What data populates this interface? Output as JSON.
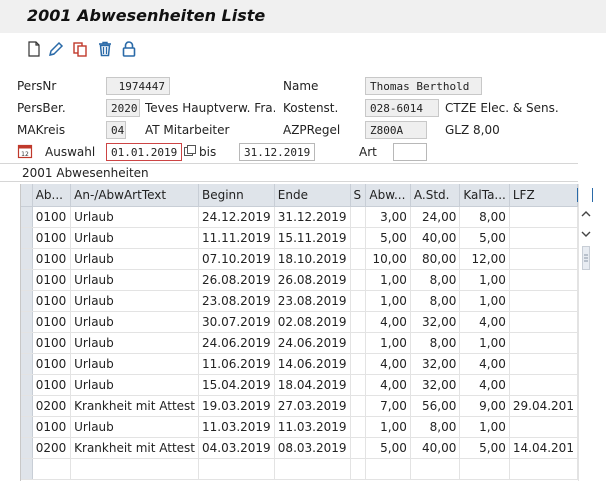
{
  "window": {
    "title": "2001 Abwesenheiten Liste"
  },
  "toolbar": {
    "icons": [
      "new-document-icon",
      "edit-pencil-icon",
      "copy-icon",
      "delete-trash-icon",
      "lock-icon"
    ]
  },
  "header": {
    "persnr_label": "PersNr",
    "persnr_value": "1974447",
    "name_label": "Name",
    "name_value": "Thomas Berthold",
    "persber_label": "PersBer.",
    "persber_value": "2020",
    "persber_text": "Teves Hauptverw. Fra...",
    "kostenst_label": "Kostenst.",
    "kostenst_value": "028-6014",
    "kostenst_text": "CTZE Elec. & Sens.",
    "makreis_label": "MAKreis",
    "makreis_value": "04",
    "makreis_text": "AT Mitarbeiter",
    "azpregel_label": "AZPRegel",
    "azpregel_value": "Z800A",
    "azpregel_text": "GLZ 8,00",
    "auswahl_label": "Auswahl",
    "auswahl_from": "01.01.2019",
    "bis_label": "bis",
    "auswahl_to": "31.12.2019",
    "art_label": "Art",
    "art_value": ""
  },
  "section": {
    "title": "2001 Abwesenheiten"
  },
  "table": {
    "columns": [
      "Ab...",
      "An-/AbwArtText",
      "Beginn",
      "Ende",
      "S",
      "Abw...",
      "A.Std.",
      "KalTa...",
      "LFZ"
    ],
    "rows": [
      [
        "0100",
        "Urlaub",
        "24.12.2019",
        "31.12.2019",
        "",
        "3,00",
        "24,00",
        "8,00",
        ""
      ],
      [
        "0100",
        "Urlaub",
        "11.11.2019",
        "15.11.2019",
        "",
        "5,00",
        "40,00",
        "5,00",
        ""
      ],
      [
        "0100",
        "Urlaub",
        "07.10.2019",
        "18.10.2019",
        "",
        "10,00",
        "80,00",
        "12,00",
        ""
      ],
      [
        "0100",
        "Urlaub",
        "26.08.2019",
        "26.08.2019",
        "",
        "1,00",
        "8,00",
        "1,00",
        ""
      ],
      [
        "0100",
        "Urlaub",
        "23.08.2019",
        "23.08.2019",
        "",
        "1,00",
        "8,00",
        "1,00",
        ""
      ],
      [
        "0100",
        "Urlaub",
        "30.07.2019",
        "02.08.2019",
        "",
        "4,00",
        "32,00",
        "4,00",
        ""
      ],
      [
        "0100",
        "Urlaub",
        "24.06.2019",
        "24.06.2019",
        "",
        "1,00",
        "8,00",
        "1,00",
        ""
      ],
      [
        "0100",
        "Urlaub",
        "11.06.2019",
        "14.06.2019",
        "",
        "4,00",
        "32,00",
        "4,00",
        ""
      ],
      [
        "0100",
        "Urlaub",
        "15.04.2019",
        "18.04.2019",
        "",
        "4,00",
        "32,00",
        "4,00",
        ""
      ],
      [
        "0200",
        "Krankheit mit Attest",
        "19.03.2019",
        "27.03.2019",
        "",
        "7,00",
        "56,00",
        "9,00",
        "29.04.201"
      ],
      [
        "0100",
        "Urlaub",
        "11.03.2019",
        "11.03.2019",
        "",
        "1,00",
        "8,00",
        "1,00",
        ""
      ],
      [
        "0200",
        "Krankheit mit Attest",
        "04.03.2019",
        "08.03.2019",
        "",
        "5,00",
        "40,00",
        "5,00",
        "14.04.201"
      ]
    ]
  }
}
